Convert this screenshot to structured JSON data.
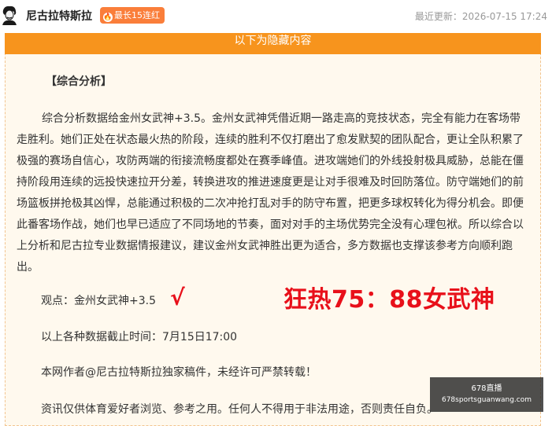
{
  "header": {
    "author": "尼古拉特斯拉",
    "streak_badge": "最长15连红",
    "updated": "最近更新：2026-07-15 17:24"
  },
  "banner": {
    "text": "以下为隐藏内容"
  },
  "content": {
    "section_title": "【综合分析】",
    "paragraph": "综合分析数据给金州女武神+3.5。金州女武神凭借近期一路走高的竞技状态，完全有能力在客场带走胜利。她们正处在状态最火热的阶段，连续的胜利不仅打磨出了愈发默契的团队配合，更让全队积累了极强的赛场自信心，攻防两端的衔接流畅度都处在赛季峰值。进攻端她们的外线投射极具威胁，总能在僵持阶段用连续的远投快速拉开分差，转换进攻的推进速度更是让对手很难及时回防落位。防守端她们的前场篮板拼抢极其凶悍，总能通过积极的二次冲抢打乱对手的防守布置，把更多球权转化为得分机会。即便此番客场作战，她们也早已适应了不同场地的节奏，面对对手的主场优势完全没有心理包袱。所以综合以上分析和尼古拉专业数据情报建议，建议金州女武神胜出更为适合，多方数据也支撑该参考方向顺利跑出。",
    "viewpoint": "观点：金州女武神+3.5",
    "checkmark": "√",
    "score": "狂热75：88女武神",
    "cutoff": "以上各种数据截止时间：7月15日17:00",
    "copyright": "本网作者@尼古拉特斯拉独家稿件，未经许可严禁转载！",
    "disclaimer": "资讯仅供体育爱好者浏览、参考之用。任何人不得用于非法用途，否则责任自负。"
  },
  "watermark": {
    "line1": "678直播",
    "line2": "678sportsguanwang.com"
  }
}
